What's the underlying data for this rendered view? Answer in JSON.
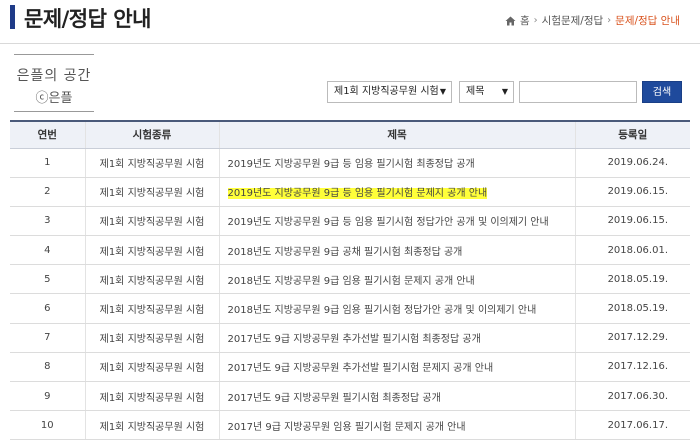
{
  "page": {
    "title": "문제/정답 안내"
  },
  "breadcrumb": {
    "home": "홈",
    "section": "시험문제/정답",
    "current": "문제/정답 안내"
  },
  "watermark": {
    "line1": "은플의 공간",
    "line2": "ⓒ은플"
  },
  "search": {
    "exam_selected": "제1회 지방직공무원 시험",
    "field_selected": "제목",
    "query": "",
    "button_label": "검색"
  },
  "table": {
    "headers": {
      "no": "연번",
      "type": "시험종류",
      "title": "제목",
      "date": "등록일"
    },
    "rows": [
      {
        "no": "1",
        "type": "제1회 지방직공무원 시험",
        "title": "2019년도 지방공무원 9급 등 임용 필기시험 최종정답 공개",
        "date": "2019.06.24."
      },
      {
        "no": "2",
        "type": "제1회 지방직공무원 시험",
        "title": "2019년도 지방공무원 9급 등 임용 필기시험 문제지 공개 안내",
        "date": "2019.06.15."
      },
      {
        "no": "3",
        "type": "제1회 지방직공무원 시험",
        "title": "2019년도 지방공무원 9급 등 임용 필기시험 정답가안 공개 및 이의제기 안내",
        "date": "2019.06.15."
      },
      {
        "no": "4",
        "type": "제1회 지방직공무원 시험",
        "title": "2018년도 지방공무원 9급 공채 필기시험 최종정답 공개",
        "date": "2018.06.01."
      },
      {
        "no": "5",
        "type": "제1회 지방직공무원 시험",
        "title": "2018년도 지방공무원 9급 임용 필기시험 문제지 공개 안내",
        "date": "2018.05.19."
      },
      {
        "no": "6",
        "type": "제1회 지방직공무원 시험",
        "title": "2018년도 지방공무원 9급 임용 필기시험 정답가안 공개 및 이의제기 안내",
        "date": "2018.05.19."
      },
      {
        "no": "7",
        "type": "제1회 지방직공무원 시험",
        "title": "2017년도 9급 지방공무원 추가선발 필기시험 최종정답 공개",
        "date": "2017.12.29."
      },
      {
        "no": "8",
        "type": "제1회 지방직공무원 시험",
        "title": "2017년도 9급 지방공무원 추가선발 필기시험 문제지 공개 안내",
        "date": "2017.12.16."
      },
      {
        "no": "9",
        "type": "제1회 지방직공무원 시험",
        "title": "2017년도 9급 지방공무원 필기시험 최종정답 공개",
        "date": "2017.06.30."
      },
      {
        "no": "10",
        "type": "제1회 지방직공무원 시험",
        "title": "2017년 9급 지방공무원 임용 필기시험 문제지 공개 안내",
        "date": "2017.06.17."
      }
    ]
  },
  "colors": {
    "accent": "#1f3b88",
    "breadcrumb_current": "#d9531e",
    "highlight": "#ffff3a",
    "button": "#1f4a9c"
  }
}
